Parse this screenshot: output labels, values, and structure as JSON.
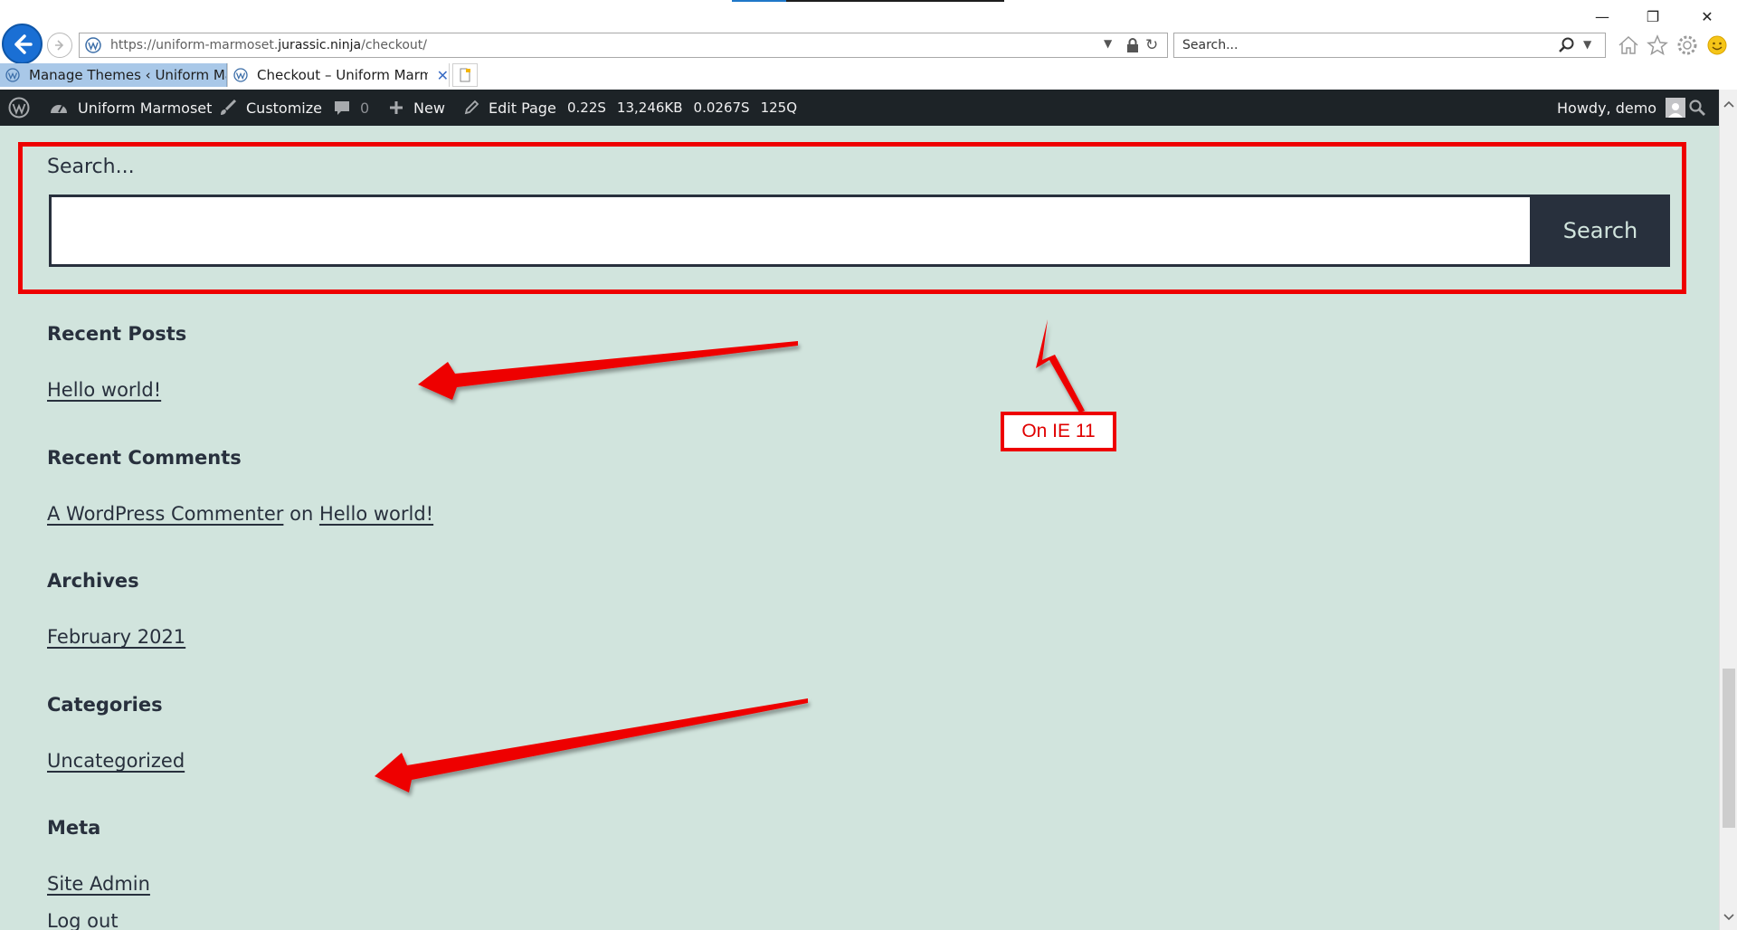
{
  "browser": {
    "address": {
      "prefix": "https://uniform-marmoset.",
      "domain": "jurassic.ninja",
      "path": "/checkout/"
    },
    "search_placeholder": "Search...",
    "tabs": [
      {
        "label": "Manage Themes ‹ Uniform Ma...",
        "active": false
      },
      {
        "label": "Checkout – Uniform Marmo...",
        "active": true
      }
    ],
    "tab_close": "✕",
    "window_controls": {
      "minimize": "—",
      "restore": "❐",
      "close": "✕"
    }
  },
  "adminbar": {
    "site_name": "Uniform Marmoset",
    "customize": "Customize",
    "comments_count": "0",
    "new": "New",
    "edit_page": "Edit Page",
    "stats": {
      "time": "0.22S",
      "memory": "13,246KB",
      "db_time": "0.0267S",
      "queries": "125Q"
    },
    "howdy": "Howdy, demo"
  },
  "content": {
    "search": {
      "label": "Search...",
      "button": "Search"
    },
    "widgets": {
      "recent_posts": {
        "title": "Recent Posts",
        "items": [
          "Hello world!"
        ]
      },
      "recent_comments": {
        "title": "Recent Comments",
        "author": "A WordPress Commenter",
        "on": "on",
        "post": "Hello world!"
      },
      "archives": {
        "title": "Archives",
        "items": [
          "February 2021"
        ]
      },
      "categories": {
        "title": "Categories",
        "items": [
          "Uncategorized"
        ]
      },
      "meta": {
        "title": "Meta",
        "items": [
          "Site Admin",
          "Log out"
        ]
      }
    }
  },
  "annotation": {
    "label": "On IE 11",
    "color": "#ee0000"
  },
  "colors": {
    "page_bg": "#d1e4dd",
    "text": "#28303d",
    "adminbar_bg": "#1d2327",
    "ie_blue": "#1a6fd4"
  }
}
